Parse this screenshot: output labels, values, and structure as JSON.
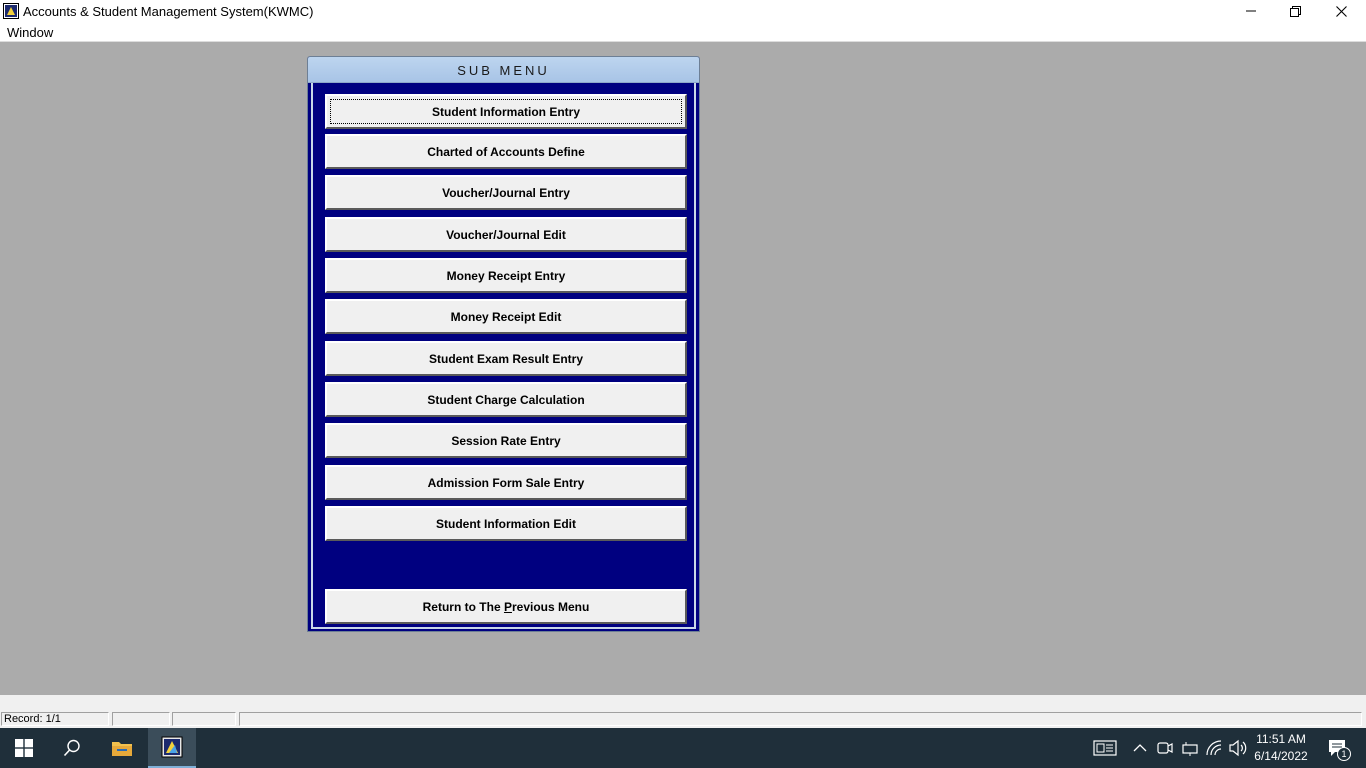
{
  "window": {
    "title": "Accounts & Student Management System(KWMC)",
    "icon": "app-icon",
    "controls": [
      "minimize-icon",
      "restore-icon",
      "close-icon"
    ]
  },
  "menubar": {
    "items": [
      {
        "label": "Window"
      }
    ]
  },
  "submenu": {
    "title": "SUB MENU",
    "buttons": [
      {
        "label": "Student Information Entry"
      },
      {
        "label": "Charted of Accounts Define"
      },
      {
        "label": "Voucher/Journal Entry"
      },
      {
        "label": "Voucher/Journal Edit"
      },
      {
        "label": "Money Receipt Entry"
      },
      {
        "label": "Money Receipt Edit"
      },
      {
        "label": "Student Exam Result Entry"
      },
      {
        "label": "Student Charge Calculation"
      },
      {
        "label": "Session Rate Entry"
      },
      {
        "label": "Admission Form Sale Entry"
      },
      {
        "label": "Student Information Edit"
      }
    ],
    "return_button": {
      "label_pre": "Return to The ",
      "label_accel": "P",
      "label_post": "revious Menu"
    }
  },
  "statusbar": {
    "record": "Record: 1/1"
  },
  "taskbar": {
    "icons": [
      "windows-start-icon",
      "search-icon",
      "file-explorer-icon",
      "kwmc-app-icon"
    ],
    "tray_icons": [
      "news-widget-icon",
      "chevron-up-icon",
      "meet-now-icon",
      "network-icon",
      "wifi-icon",
      "volume-icon",
      "notification-icon"
    ],
    "time": "11:51 AM",
    "date": "6/14/2022",
    "notification_count": "1"
  },
  "colors": {
    "submenu_bg": "#000080",
    "desktop_bg": "#ababab",
    "taskbar_bg": "#1f2f3a"
  }
}
